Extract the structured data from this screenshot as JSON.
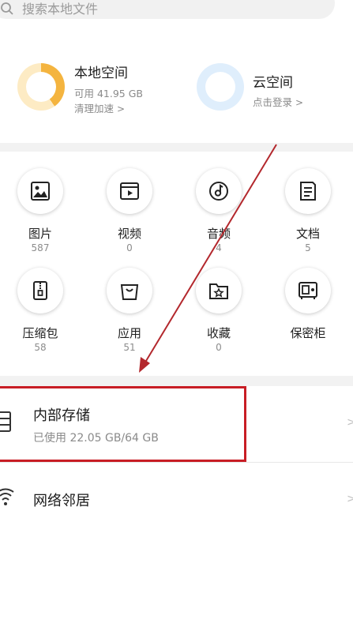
{
  "search": {
    "placeholder": "搜索本地文件"
  },
  "storage": {
    "local": {
      "title": "本地空间",
      "available": "可用 41.95 GB",
      "action": "清理加速"
    },
    "cloud": {
      "title": "云空间",
      "action": "点击登录"
    }
  },
  "categories": [
    {
      "label": "图片",
      "count": "587",
      "icon": "image-icon"
    },
    {
      "label": "视频",
      "count": "0",
      "icon": "video-icon"
    },
    {
      "label": "音频",
      "count": "4",
      "icon": "audio-icon"
    },
    {
      "label": "文档",
      "count": "5",
      "icon": "document-icon"
    },
    {
      "label": "压缩包",
      "count": "58",
      "icon": "archive-icon"
    },
    {
      "label": "应用",
      "count": "51",
      "icon": "app-bag-icon"
    },
    {
      "label": "收藏",
      "count": "0",
      "icon": "favorite-folder-icon"
    },
    {
      "label": "保密柜",
      "count": "",
      "icon": "safe-icon"
    }
  ],
  "locations": {
    "internal": {
      "title": "内部存储",
      "usage": "已使用 22.05 GB/64 GB"
    },
    "network": {
      "title": "网络邻居"
    }
  },
  "colors": {
    "local_ring": "#f4b43f",
    "cloud_ring": "#dfeefc",
    "highlight_border": "#c81d25",
    "annotation_arrow": "#b3282d"
  }
}
